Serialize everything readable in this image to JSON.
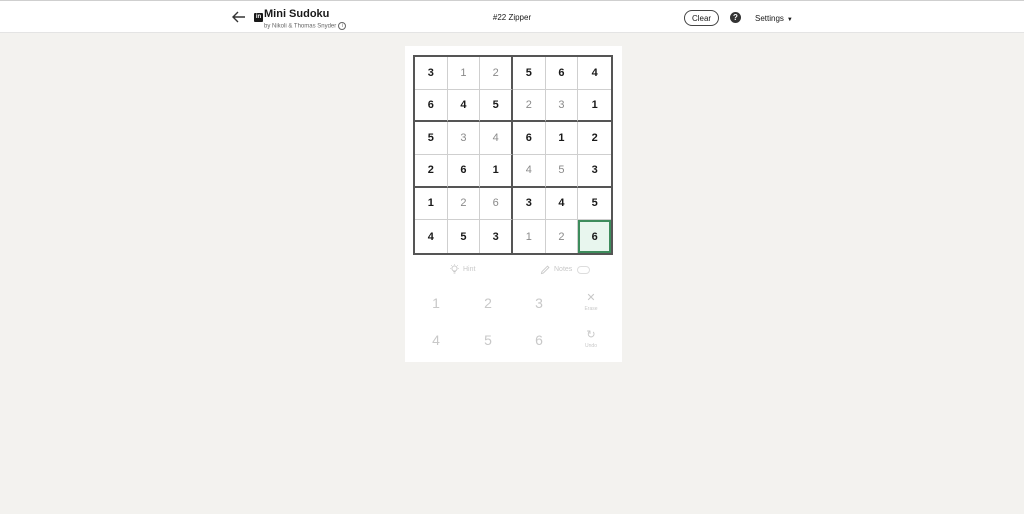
{
  "header": {
    "app_title": "Mini Sudoku",
    "byline": "by Nikoli & Thomas Snyder",
    "puzzle_name": "#22 Zipper",
    "clear_label": "Clear",
    "help_label": "?",
    "settings_label": "Settings",
    "logo_text": "in"
  },
  "grid": {
    "rows": [
      [
        {
          "v": "3",
          "t": "given"
        },
        {
          "v": "1",
          "t": "user"
        },
        {
          "v": "2",
          "t": "user"
        },
        {
          "v": "5",
          "t": "given"
        },
        {
          "v": "6",
          "t": "given"
        },
        {
          "v": "4",
          "t": "given"
        }
      ],
      [
        {
          "v": "6",
          "t": "given"
        },
        {
          "v": "4",
          "t": "given"
        },
        {
          "v": "5",
          "t": "given"
        },
        {
          "v": "2",
          "t": "user"
        },
        {
          "v": "3",
          "t": "user"
        },
        {
          "v": "1",
          "t": "given"
        }
      ],
      [
        {
          "v": "5",
          "t": "given"
        },
        {
          "v": "3",
          "t": "user"
        },
        {
          "v": "4",
          "t": "user"
        },
        {
          "v": "6",
          "t": "given"
        },
        {
          "v": "1",
          "t": "given"
        },
        {
          "v": "2",
          "t": "given"
        }
      ],
      [
        {
          "v": "2",
          "t": "given"
        },
        {
          "v": "6",
          "t": "given"
        },
        {
          "v": "1",
          "t": "given"
        },
        {
          "v": "4",
          "t": "user"
        },
        {
          "v": "5",
          "t": "user"
        },
        {
          "v": "3",
          "t": "given"
        }
      ],
      [
        {
          "v": "1",
          "t": "given"
        },
        {
          "v": "2",
          "t": "user"
        },
        {
          "v": "6",
          "t": "user"
        },
        {
          "v": "3",
          "t": "given"
        },
        {
          "v": "4",
          "t": "given"
        },
        {
          "v": "5",
          "t": "given"
        }
      ],
      [
        {
          "v": "4",
          "t": "given"
        },
        {
          "v": "5",
          "t": "given"
        },
        {
          "v": "3",
          "t": "given"
        },
        {
          "v": "1",
          "t": "user"
        },
        {
          "v": "2",
          "t": "user"
        },
        {
          "v": "6",
          "t": "selected"
        }
      ]
    ]
  },
  "tools": {
    "hint_label": "Hint",
    "notes_label": "Notes",
    "notes_toggle": "off"
  },
  "keypad": {
    "numbers": [
      "1",
      "2",
      "3",
      "4",
      "5",
      "6"
    ],
    "erase_label": "Erase",
    "undo_label": "Undo"
  },
  "colors": {
    "selected_outline": "#3d8c5c",
    "selected_fill": "#e8f6ee",
    "background": "#f3f2ef"
  }
}
